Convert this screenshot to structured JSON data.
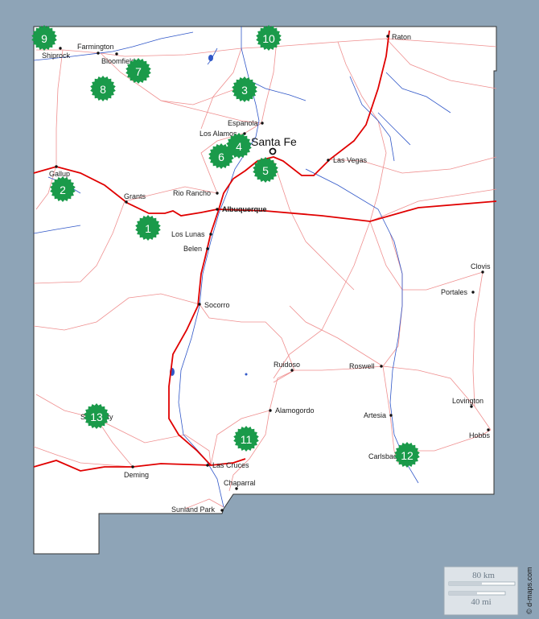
{
  "map": {
    "colors": {
      "outside": "#8ea4b7",
      "land": "#ffffff",
      "major_road": "#e00000",
      "minor_road": "#ef8f8f",
      "river": "#3057c8",
      "marker": "#1a9a4a"
    },
    "capital": {
      "name": "Santa Fe"
    },
    "cities": [
      {
        "id": "shiprock",
        "name": "Shiprock"
      },
      {
        "id": "farmington",
        "name": "Farmington"
      },
      {
        "id": "bloomfield",
        "name": "Bloomfield"
      },
      {
        "id": "raton",
        "name": "Raton"
      },
      {
        "id": "espanola",
        "name": "Espanola"
      },
      {
        "id": "los-alamos",
        "name": "Los Alamos"
      },
      {
        "id": "las-vegas",
        "name": "Las Vegas"
      },
      {
        "id": "gallup",
        "name": "Gallup"
      },
      {
        "id": "grants",
        "name": "Grants"
      },
      {
        "id": "rio-rancho",
        "name": "Rio Rancho"
      },
      {
        "id": "albuquerque",
        "name": "Albuquerque"
      },
      {
        "id": "los-lunas",
        "name": "Los Lunas"
      },
      {
        "id": "belen",
        "name": "Belen"
      },
      {
        "id": "clovis",
        "name": "Clovis"
      },
      {
        "id": "portales",
        "name": "Portales"
      },
      {
        "id": "socorro",
        "name": "Socorro"
      },
      {
        "id": "ruidoso",
        "name": "Ruidoso"
      },
      {
        "id": "roswell",
        "name": "Roswell"
      },
      {
        "id": "lovington",
        "name": "Lovington"
      },
      {
        "id": "alamogordo",
        "name": "Alamogordo"
      },
      {
        "id": "artesia",
        "name": "Artesia"
      },
      {
        "id": "hobbs",
        "name": "Hobbs"
      },
      {
        "id": "silver-city",
        "name": "Silver City"
      },
      {
        "id": "carlsbad",
        "name": "Carlsbad"
      },
      {
        "id": "las-cruces",
        "name": "Las Cruces"
      },
      {
        "id": "deming",
        "name": "Deming"
      },
      {
        "id": "chaparral",
        "name": "Chaparral"
      },
      {
        "id": "sunland-park",
        "name": "Sunland Park"
      }
    ],
    "markers": [
      "1",
      "2",
      "3",
      "4",
      "5",
      "6",
      "7",
      "8",
      "9",
      "10",
      "11",
      "12",
      "13"
    ],
    "scale": {
      "km_label": "80 km",
      "mi_label": "40 mi"
    },
    "credit": "© d-maps.com"
  }
}
